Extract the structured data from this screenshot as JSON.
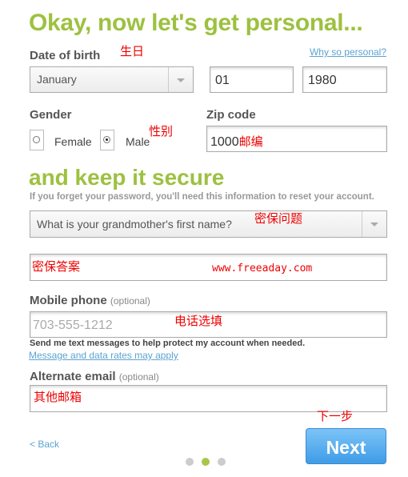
{
  "title": "Okay, now let's get personal...",
  "dob": {
    "label": "Date of birth",
    "why_link": "Why so personal?",
    "month": "January",
    "day": "01",
    "year": "1980"
  },
  "gender": {
    "label": "Gender",
    "female": "Female",
    "male": "Male",
    "selected": "Male"
  },
  "zip": {
    "label": "Zip code",
    "value": "1000"
  },
  "secure": {
    "title": "and keep it secure",
    "helper": "If you forget your password, you'll need this information to reset your account.",
    "question": "What is your grandmother's first name?"
  },
  "mobile": {
    "label": "Mobile phone",
    "optional": "(optional)",
    "placeholder": "703-555-1212",
    "note": "Send me text messages to help protect my account when needed.",
    "rates_link": "Message and data rates may apply"
  },
  "alt_email": {
    "label": "Alternate email",
    "optional": "(optional)"
  },
  "nav": {
    "back": "< Back",
    "next": "Next",
    "step_current": 2,
    "step_total": 3
  },
  "annotations": {
    "birthday": "生日",
    "gender": "性别",
    "zip": "邮编",
    "question": "密保问题",
    "answer": "密保答案",
    "watermark": "www.freeaday.com",
    "phone": "电话选填",
    "email": "其他邮箱",
    "next": "下一步"
  },
  "colors": {
    "accent": "#9dc140",
    "link": "#5ba3d0",
    "button": "#4aa6ec",
    "annotation": "#e00000"
  }
}
